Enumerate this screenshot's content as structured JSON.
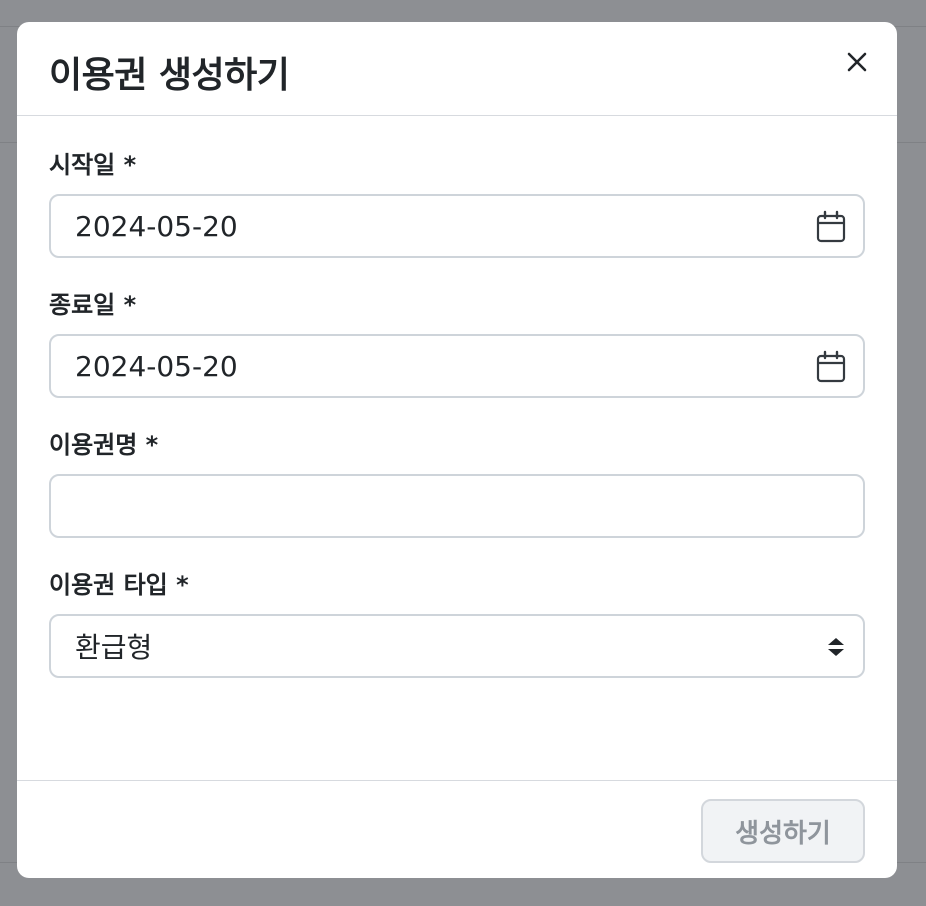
{
  "modal": {
    "title": "이용권 생성하기",
    "close_icon": "close-icon"
  },
  "form": {
    "start_date": {
      "label": "시작일 *",
      "value": "2024-05-20",
      "icon": "calendar-icon"
    },
    "end_date": {
      "label": "종료일 *",
      "value": "2024-05-20",
      "icon": "calendar-icon"
    },
    "pass_name": {
      "label": "이용권명 *",
      "value": "",
      "placeholder": ""
    },
    "pass_type": {
      "label": "이용권 타입 *",
      "selected": "환급형",
      "icon": "select-arrows-icon"
    }
  },
  "footer": {
    "create_label": "생성하기"
  }
}
